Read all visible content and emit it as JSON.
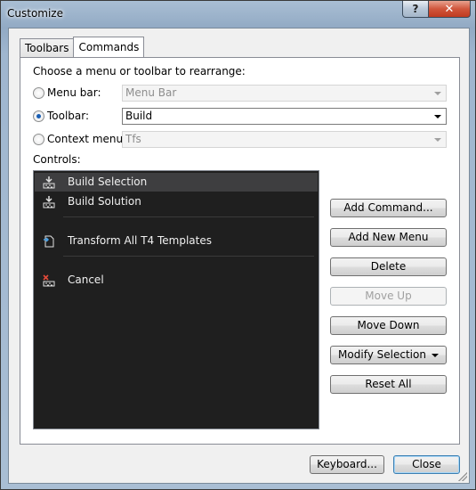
{
  "window": {
    "title": "Customize",
    "help_label": "?",
    "close_label": "✕"
  },
  "tabs": [
    {
      "label": "Toolbars"
    },
    {
      "label": "Commands"
    }
  ],
  "commands": {
    "choose_label": "Choose a menu or toolbar to rearrange:",
    "menu_bar": {
      "label": "Menu bar:",
      "value": "Menu Bar",
      "selected": false,
      "enabled": false
    },
    "toolbar": {
      "label": "Toolbar:",
      "value": "Build",
      "selected": true,
      "enabled": true
    },
    "context_menu": {
      "label": "Context menu:",
      "value": "Tfs",
      "selected": false,
      "enabled": false
    },
    "controls_label": "Controls:",
    "controls": [
      {
        "label": "Build Selection",
        "icon": "build-selection-icon",
        "selected": true
      },
      {
        "label": "Build Solution",
        "icon": "build-solution-icon",
        "selected": false
      },
      {
        "label": "Transform All T4 Templates",
        "icon": "transform-templates-icon",
        "selected": false
      },
      {
        "label": "Cancel",
        "icon": "cancel-build-icon",
        "selected": false
      }
    ],
    "buttons": {
      "add_command": "Add Command...",
      "add_new_menu": "Add New Menu",
      "delete": "Delete",
      "move_up": "Move Up",
      "move_down": "Move Down",
      "modify_selection": "Modify Selection",
      "reset_all": "Reset All"
    }
  },
  "footer": {
    "keyboard": "Keyboard...",
    "close": "Close"
  }
}
